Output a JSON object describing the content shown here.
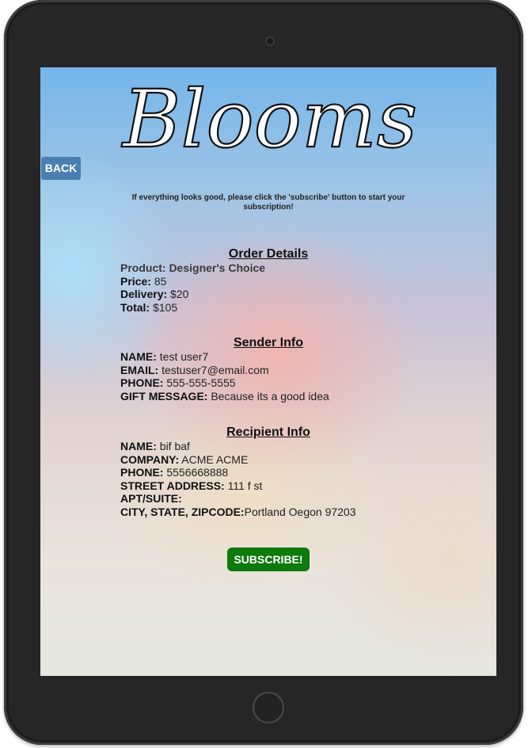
{
  "logo_text": "Blooms",
  "back_label": "BACK",
  "instructions": "If everything looks good, please click the 'subscribe' button to start your subscription!",
  "order": {
    "title": "Order Details",
    "product": "Product: Designer's Choice",
    "price_label": "Price:",
    "price": "85",
    "delivery_label": "Delivery:",
    "delivery": "$20",
    "total_label": "Total:",
    "total": "$105"
  },
  "sender": {
    "title": "Sender Info",
    "name_label": "NAME:",
    "name": "test user7",
    "email_label": "EMAIL:",
    "email": "testuser7@email.com",
    "phone_label": "PHONE:",
    "phone": "555-555-5555",
    "gift_label": "GIFT MESSAGE:",
    "gift": "Because its a good idea"
  },
  "recipient": {
    "title": "Recipient Info",
    "name_label": "NAME:",
    "name": "bif baf",
    "company_label": "COMPANY:",
    "company": "ACME ACME",
    "phone_label": "PHONE:",
    "phone": "5556668888",
    "street_label": "STREET ADDRESS:",
    "street": "111 f st",
    "apt_label": "APT/SUITE:",
    "apt": "",
    "city_label": "CITY, STATE, ZIPCODE:",
    "city": "Portland Oegon 97203"
  },
  "subscribe_label": "SUBSCRIBE!",
  "colors": {
    "back_button": "#4a7fb0",
    "subscribe_button": "#0d7a0d",
    "device_frame": "#262626"
  }
}
